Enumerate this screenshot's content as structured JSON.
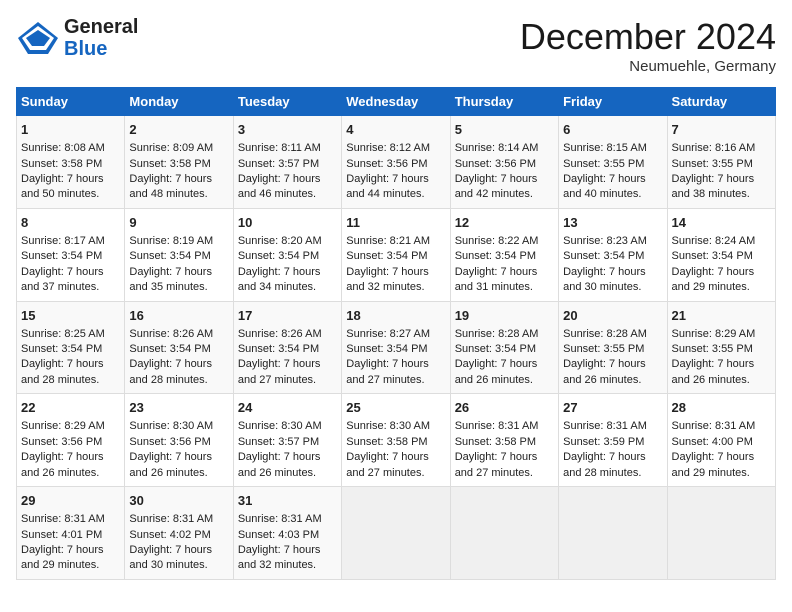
{
  "header": {
    "logo_general": "General",
    "logo_blue": "Blue",
    "month": "December 2024",
    "location": "Neumuehle, Germany"
  },
  "days_of_week": [
    "Sunday",
    "Monday",
    "Tuesday",
    "Wednesday",
    "Thursday",
    "Friday",
    "Saturday"
  ],
  "weeks": [
    [
      {
        "day": "1",
        "sunrise": "Sunrise: 8:08 AM",
        "sunset": "Sunset: 3:58 PM",
        "daylight": "Daylight: 7 hours and 50 minutes."
      },
      {
        "day": "2",
        "sunrise": "Sunrise: 8:09 AM",
        "sunset": "Sunset: 3:58 PM",
        "daylight": "Daylight: 7 hours and 48 minutes."
      },
      {
        "day": "3",
        "sunrise": "Sunrise: 8:11 AM",
        "sunset": "Sunset: 3:57 PM",
        "daylight": "Daylight: 7 hours and 46 minutes."
      },
      {
        "day": "4",
        "sunrise": "Sunrise: 8:12 AM",
        "sunset": "Sunset: 3:56 PM",
        "daylight": "Daylight: 7 hours and 44 minutes."
      },
      {
        "day": "5",
        "sunrise": "Sunrise: 8:14 AM",
        "sunset": "Sunset: 3:56 PM",
        "daylight": "Daylight: 7 hours and 42 minutes."
      },
      {
        "day": "6",
        "sunrise": "Sunrise: 8:15 AM",
        "sunset": "Sunset: 3:55 PM",
        "daylight": "Daylight: 7 hours and 40 minutes."
      },
      {
        "day": "7",
        "sunrise": "Sunrise: 8:16 AM",
        "sunset": "Sunset: 3:55 PM",
        "daylight": "Daylight: 7 hours and 38 minutes."
      }
    ],
    [
      {
        "day": "8",
        "sunrise": "Sunrise: 8:17 AM",
        "sunset": "Sunset: 3:54 PM",
        "daylight": "Daylight: 7 hours and 37 minutes."
      },
      {
        "day": "9",
        "sunrise": "Sunrise: 8:19 AM",
        "sunset": "Sunset: 3:54 PM",
        "daylight": "Daylight: 7 hours and 35 minutes."
      },
      {
        "day": "10",
        "sunrise": "Sunrise: 8:20 AM",
        "sunset": "Sunset: 3:54 PM",
        "daylight": "Daylight: 7 hours and 34 minutes."
      },
      {
        "day": "11",
        "sunrise": "Sunrise: 8:21 AM",
        "sunset": "Sunset: 3:54 PM",
        "daylight": "Daylight: 7 hours and 32 minutes."
      },
      {
        "day": "12",
        "sunrise": "Sunrise: 8:22 AM",
        "sunset": "Sunset: 3:54 PM",
        "daylight": "Daylight: 7 hours and 31 minutes."
      },
      {
        "day": "13",
        "sunrise": "Sunrise: 8:23 AM",
        "sunset": "Sunset: 3:54 PM",
        "daylight": "Daylight: 7 hours and 30 minutes."
      },
      {
        "day": "14",
        "sunrise": "Sunrise: 8:24 AM",
        "sunset": "Sunset: 3:54 PM",
        "daylight": "Daylight: 7 hours and 29 minutes."
      }
    ],
    [
      {
        "day": "15",
        "sunrise": "Sunrise: 8:25 AM",
        "sunset": "Sunset: 3:54 PM",
        "daylight": "Daylight: 7 hours and 28 minutes."
      },
      {
        "day": "16",
        "sunrise": "Sunrise: 8:26 AM",
        "sunset": "Sunset: 3:54 PM",
        "daylight": "Daylight: 7 hours and 28 minutes."
      },
      {
        "day": "17",
        "sunrise": "Sunrise: 8:26 AM",
        "sunset": "Sunset: 3:54 PM",
        "daylight": "Daylight: 7 hours and 27 minutes."
      },
      {
        "day": "18",
        "sunrise": "Sunrise: 8:27 AM",
        "sunset": "Sunset: 3:54 PM",
        "daylight": "Daylight: 7 hours and 27 minutes."
      },
      {
        "day": "19",
        "sunrise": "Sunrise: 8:28 AM",
        "sunset": "Sunset: 3:54 PM",
        "daylight": "Daylight: 7 hours and 26 minutes."
      },
      {
        "day": "20",
        "sunrise": "Sunrise: 8:28 AM",
        "sunset": "Sunset: 3:55 PM",
        "daylight": "Daylight: 7 hours and 26 minutes."
      },
      {
        "day": "21",
        "sunrise": "Sunrise: 8:29 AM",
        "sunset": "Sunset: 3:55 PM",
        "daylight": "Daylight: 7 hours and 26 minutes."
      }
    ],
    [
      {
        "day": "22",
        "sunrise": "Sunrise: 8:29 AM",
        "sunset": "Sunset: 3:56 PM",
        "daylight": "Daylight: 7 hours and 26 minutes."
      },
      {
        "day": "23",
        "sunrise": "Sunrise: 8:30 AM",
        "sunset": "Sunset: 3:56 PM",
        "daylight": "Daylight: 7 hours and 26 minutes."
      },
      {
        "day": "24",
        "sunrise": "Sunrise: 8:30 AM",
        "sunset": "Sunset: 3:57 PM",
        "daylight": "Daylight: 7 hours and 26 minutes."
      },
      {
        "day": "25",
        "sunrise": "Sunrise: 8:30 AM",
        "sunset": "Sunset: 3:58 PM",
        "daylight": "Daylight: 7 hours and 27 minutes."
      },
      {
        "day": "26",
        "sunrise": "Sunrise: 8:31 AM",
        "sunset": "Sunset: 3:58 PM",
        "daylight": "Daylight: 7 hours and 27 minutes."
      },
      {
        "day": "27",
        "sunrise": "Sunrise: 8:31 AM",
        "sunset": "Sunset: 3:59 PM",
        "daylight": "Daylight: 7 hours and 28 minutes."
      },
      {
        "day": "28",
        "sunrise": "Sunrise: 8:31 AM",
        "sunset": "Sunset: 4:00 PM",
        "daylight": "Daylight: 7 hours and 29 minutes."
      }
    ],
    [
      {
        "day": "29",
        "sunrise": "Sunrise: 8:31 AM",
        "sunset": "Sunset: 4:01 PM",
        "daylight": "Daylight: 7 hours and 29 minutes."
      },
      {
        "day": "30",
        "sunrise": "Sunrise: 8:31 AM",
        "sunset": "Sunset: 4:02 PM",
        "daylight": "Daylight: 7 hours and 30 minutes."
      },
      {
        "day": "31",
        "sunrise": "Sunrise: 8:31 AM",
        "sunset": "Sunset: 4:03 PM",
        "daylight": "Daylight: 7 hours and 32 minutes."
      },
      null,
      null,
      null,
      null
    ]
  ]
}
